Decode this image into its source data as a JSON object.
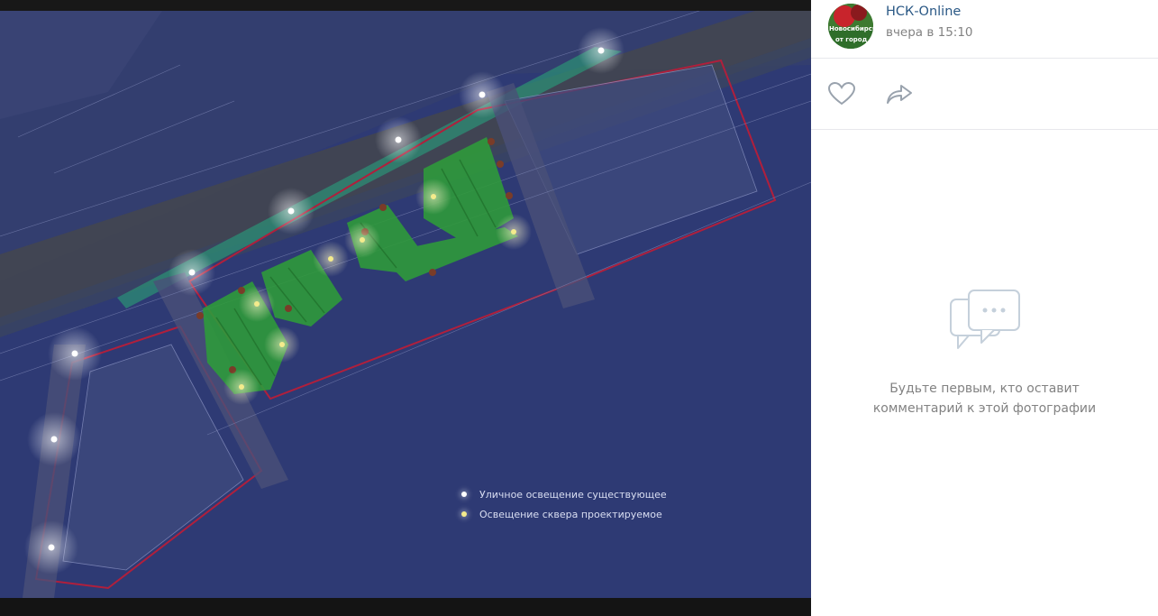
{
  "photo": {
    "legend": [
      {
        "label": "Уличное освещение существующее",
        "color": "#ffffff"
      },
      {
        "label": "Освещение сквера проектируемое",
        "color": "#f4eb8c"
      }
    ],
    "colors": {
      "background": "#2e3a74",
      "greenery": "#2f9a3b",
      "boundary": "#b01f3c"
    }
  },
  "post": {
    "author": "НСК-Online",
    "time": "вчера в 15:10",
    "avatar_caption": "Новосибирск",
    "avatar_subcaption": "от город"
  },
  "actions": {
    "like_icon": "heart-icon",
    "share_icon": "share-arrow-icon"
  },
  "comments": {
    "empty_text": "Будьте первым, кто оставит комментарий к этой фотографии"
  }
}
